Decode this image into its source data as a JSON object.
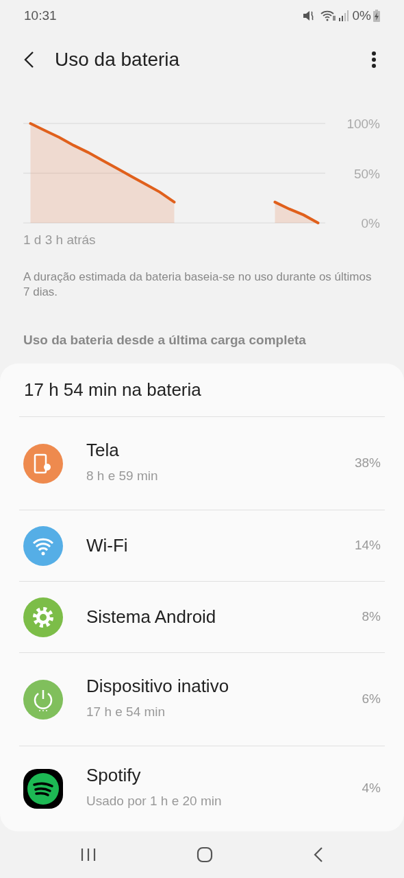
{
  "status_bar": {
    "time": "10:31",
    "battery": "0%"
  },
  "header": {
    "title": "Uso da bateria"
  },
  "chart_data": {
    "type": "area",
    "categories": [
      null,
      null,
      null,
      null,
      null,
      null,
      null,
      null,
      null,
      null,
      null,
      null,
      null,
      null,
      null,
      null,
      null,
      null,
      null,
      null,
      null
    ],
    "series": [
      {
        "color": "#e0601c",
        "values": [
          100,
          93,
          86,
          78,
          71,
          63,
          55,
          47,
          39,
          31,
          21,
          null,
          null,
          null,
          null,
          null,
          null,
          21,
          14,
          8,
          0
        ]
      }
    ],
    "ylim": [
      0,
      100
    ],
    "xlabel": "1 d 3 h atrás",
    "yticks": [
      {
        "value": 0,
        "label": "0%"
      },
      {
        "value": 50,
        "label": "50%"
      },
      {
        "value": 100,
        "label": "100%"
      }
    ]
  },
  "note": "A duração estimada da bateria baseia-se no uso durante os últimos 7 dias.",
  "section_title": "Uso da bateria desde a última carga completa",
  "card": {
    "total": "17 h 54 min na bateria",
    "items": [
      {
        "name": "Tela",
        "detail": "8 h e 59 min",
        "percent": "38%",
        "color": "#ee8a4e"
      },
      {
        "name": "Wi-Fi",
        "percent": "14%",
        "color": "#55aee6"
      },
      {
        "name": "Sistema Android",
        "percent": "8%",
        "color": "#7cbd48"
      },
      {
        "name": "Dispositivo inativo",
        "detail": "17 h e 54 min",
        "percent": "6%",
        "color": "#80bf5c"
      },
      {
        "name": "Spotify",
        "detail": "Usado por 1 h e 20 min",
        "percent": "4%",
        "color": "#1db954"
      }
    ]
  }
}
